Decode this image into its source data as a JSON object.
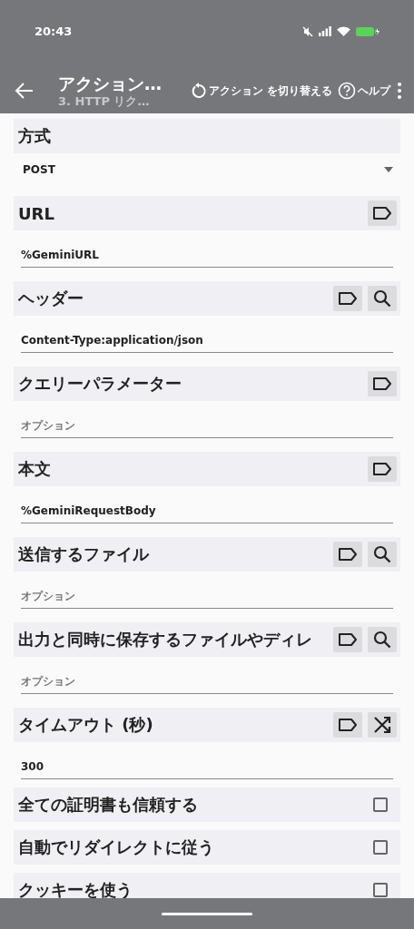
{
  "status_bar": {
    "time": "20:43"
  },
  "app_bar": {
    "title": "アクション…",
    "subtitle": "3. HTTP リク…",
    "actions": [
      {
        "kind": "switch",
        "label": "アクション を切り替える"
      },
      {
        "kind": "help",
        "label": "ヘルプ"
      },
      {
        "kind": "more"
      }
    ]
  },
  "sections": [
    {
      "kind": "dropdown",
      "label": "方式",
      "value": "POST"
    },
    {
      "kind": "field",
      "label": "URL",
      "buttons": [
        {
          "kind": "tag"
        }
      ],
      "value": "%GeminiURL"
    },
    {
      "kind": "field",
      "label": "ヘッダー",
      "buttons": [
        {
          "kind": "tag"
        },
        {
          "kind": "search"
        }
      ],
      "value": "Content-Type:application/json"
    },
    {
      "kind": "field",
      "label": "クエリーパラメーター",
      "buttons": [
        {
          "kind": "tag"
        }
      ],
      "placeholder": "オプション"
    },
    {
      "kind": "field",
      "label": "本文",
      "buttons": [
        {
          "kind": "tag"
        }
      ],
      "value": "%GeminiRequestBody"
    },
    {
      "kind": "field",
      "label": "送信するファイル",
      "buttons": [
        {
          "kind": "tag"
        },
        {
          "kind": "search"
        }
      ],
      "placeholder": "オプション"
    },
    {
      "kind": "field",
      "label": "出力と同時に保存するファイルやディレ",
      "buttons": [
        {
          "kind": "tag"
        },
        {
          "kind": "search"
        }
      ],
      "placeholder": "オプション"
    },
    {
      "kind": "field",
      "label": "タイムアウト (秒)",
      "buttons": [
        {
          "kind": "tag"
        },
        {
          "kind": "shuffle"
        }
      ],
      "value": "300"
    },
    {
      "kind": "checkbox",
      "label": "全ての証明書も信頼する",
      "checked": false
    },
    {
      "kind": "checkbox",
      "label": "自動でリダイレクトに従う",
      "checked": false
    },
    {
      "kind": "checkbox",
      "label": "クッキーを使う",
      "checked": false
    }
  ]
}
